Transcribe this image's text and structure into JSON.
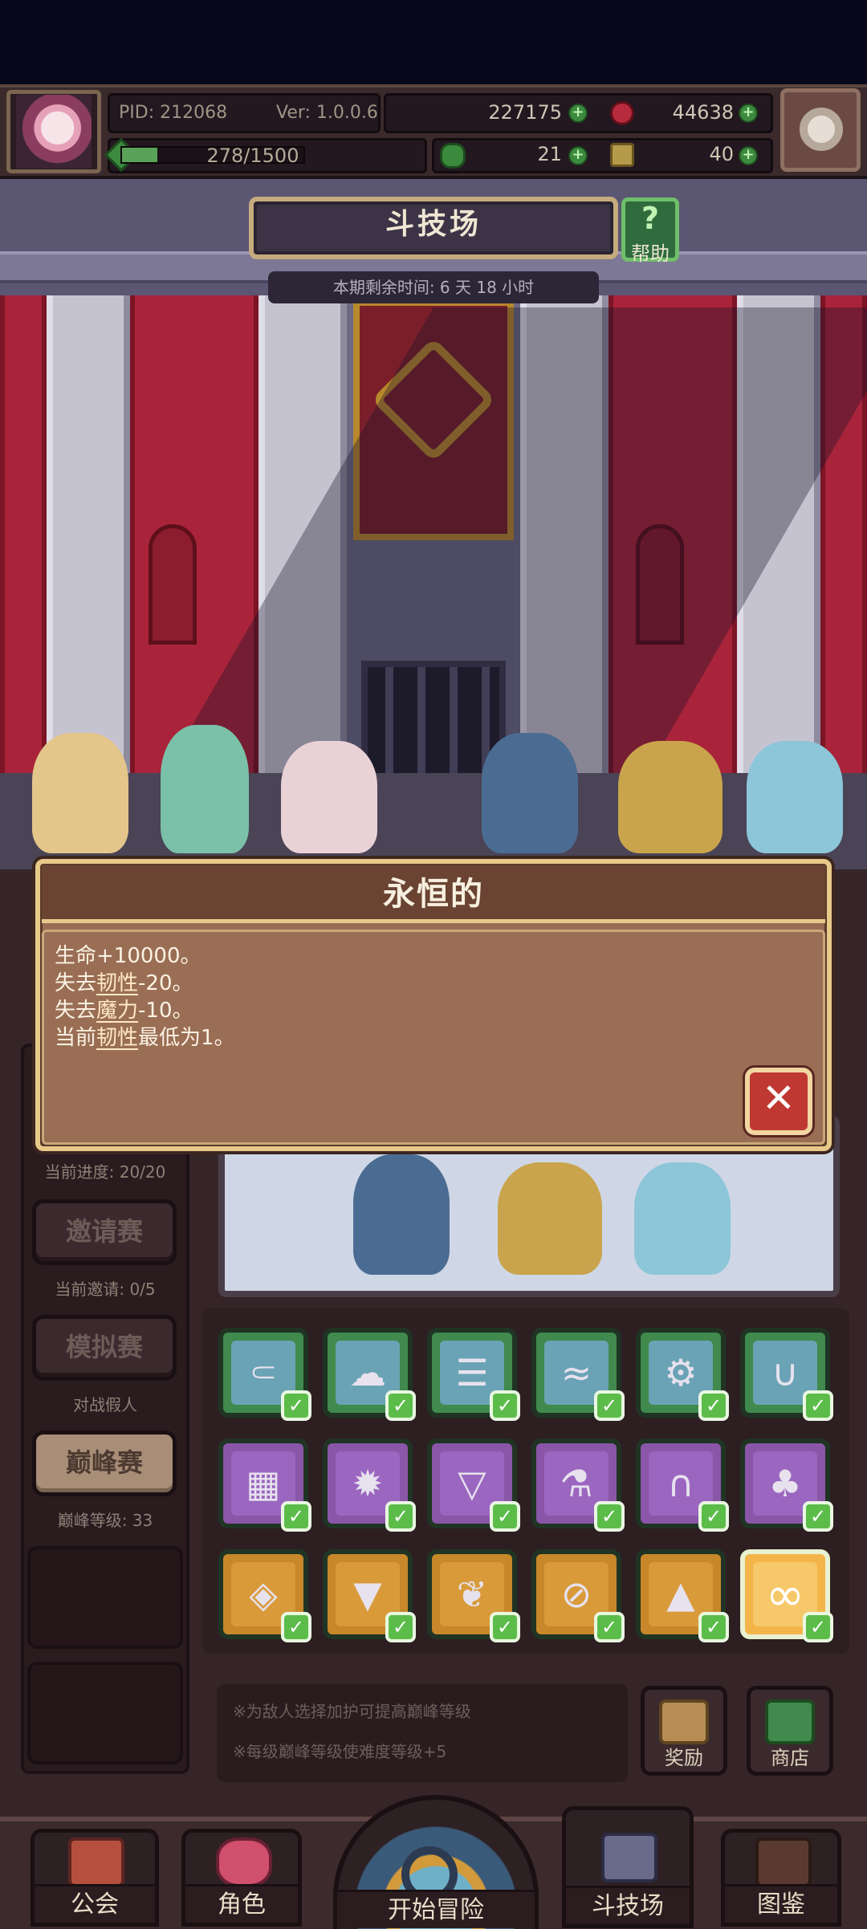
{
  "header": {
    "pid": "PID: 212068",
    "version": "Ver: 1.0.0.6",
    "gold": "227175",
    "gems": "44638",
    "exp": "278/1500",
    "clover": "21",
    "keys": "40"
  },
  "arena": {
    "title": "斗技场",
    "help_label": "帮助",
    "timer": "本期剩余时间: 6 天 18 小时"
  },
  "sidebar": {
    "progress": "当前进度: 20/20",
    "invite_button": "邀请赛",
    "invite_caption": "当前邀请: 0/5",
    "sim_button": "模拟赛",
    "sim_caption": "对战假人",
    "peak_button": "巅峰赛",
    "peak_caption": "巅峰等级: 33"
  },
  "notes": {
    "line1": "※为敌人选择加护可提高巅峰等级",
    "line2": "※每级巅峰等级使难度等级+5"
  },
  "side_buttons": {
    "reward": "奖励",
    "shop": "商店"
  },
  "modal": {
    "title": "永恒的",
    "line1": "生命+10000。",
    "line2_prefix": "失去",
    "line2_term": "韧性",
    "line2_suffix": "-20。",
    "line3_prefix": "失去",
    "line3_term": "魔力",
    "line3_suffix": "-10。",
    "line4_prefix": "当前",
    "line4_term": "韧性",
    "line4_suffix": "最低为1。"
  },
  "bottom_nav": {
    "guild": "公会",
    "character": "角色",
    "start": "开始冒险",
    "arena": "斗技场",
    "codex": "图鉴"
  },
  "blessing_tiles": [
    {
      "icon": "crook-icon",
      "glyph": "⸦",
      "color": "green"
    },
    {
      "icon": "swirl-icon",
      "glyph": "☁",
      "color": "green"
    },
    {
      "icon": "funnel-icon",
      "glyph": "☰",
      "color": "green"
    },
    {
      "icon": "wave-icon",
      "glyph": "≈",
      "color": "green"
    },
    {
      "icon": "gear-rune-icon",
      "glyph": "⚙",
      "color": "green"
    },
    {
      "icon": "magnet-icon",
      "glyph": "∪",
      "color": "green"
    },
    {
      "icon": "brick-icon",
      "glyph": "▦",
      "color": "purple"
    },
    {
      "icon": "burst-icon",
      "glyph": "✹",
      "color": "purple"
    },
    {
      "icon": "shield-icon",
      "glyph": "▽",
      "color": "purple"
    },
    {
      "icon": "potion-icon",
      "glyph": "⚗",
      "color": "purple"
    },
    {
      "icon": "arch-icon",
      "glyph": "∩",
      "color": "purple"
    },
    {
      "icon": "tree-icon",
      "glyph": "♣",
      "color": "purple"
    },
    {
      "icon": "eye-rune-icon",
      "glyph": "◈",
      "color": "orange"
    },
    {
      "icon": "triangle-rune-icon",
      "glyph": "▼",
      "color": "orange"
    },
    {
      "icon": "shell-icon",
      "glyph": "❦",
      "color": "orange"
    },
    {
      "icon": "disc-icon",
      "glyph": "⊘",
      "color": "orange"
    },
    {
      "icon": "drop-icon",
      "glyph": "▲",
      "color": "orange"
    },
    {
      "icon": "infinity-icon",
      "glyph": "∞",
      "color": "orange-selected"
    }
  ]
}
